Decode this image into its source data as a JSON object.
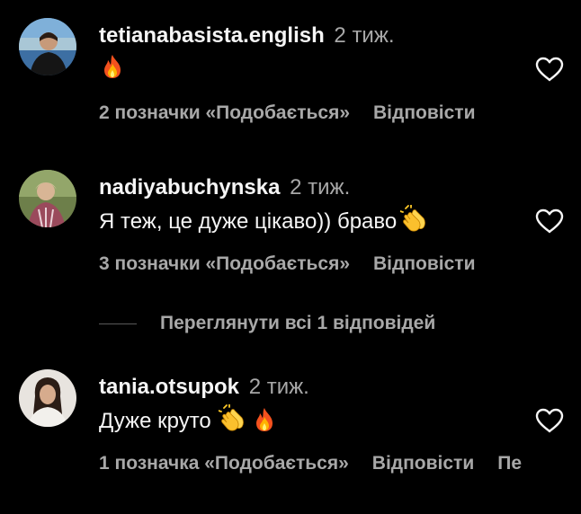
{
  "comments": [
    {
      "username": "tetianabasista.english",
      "time": "2 тиж.",
      "text": "",
      "emojis": [
        "fire"
      ],
      "likes": "2 позначки «Подобається»",
      "reply": "Відповісти",
      "extra": ""
    },
    {
      "username": "nadiyabuchynska",
      "time": "2 тиж.",
      "text": "Я теж, це дуже цікаво)) браво",
      "emojis": [
        "clap"
      ],
      "likes": "3 позначки «Подобається»",
      "reply": "Відповісти",
      "extra": ""
    },
    {
      "username": "tania.otsupok",
      "time": "2 тиж.",
      "text": "Дуже круто",
      "emojis": [
        "clap",
        "fire"
      ],
      "likes": "1 позначка «Подобається»",
      "reply": "Відповісти",
      "extra": "Пе"
    }
  ],
  "view_replies": {
    "label": "Переглянути всі 1 відповідей"
  },
  "icons": {
    "like": "heart-outline-icon",
    "fire": "fire-emoji",
    "clap": "clapping-hands-emoji"
  },
  "colors": {
    "background": "#000000",
    "primary_text": "#f5f5f5",
    "secondary_text": "#a8a8a8"
  }
}
